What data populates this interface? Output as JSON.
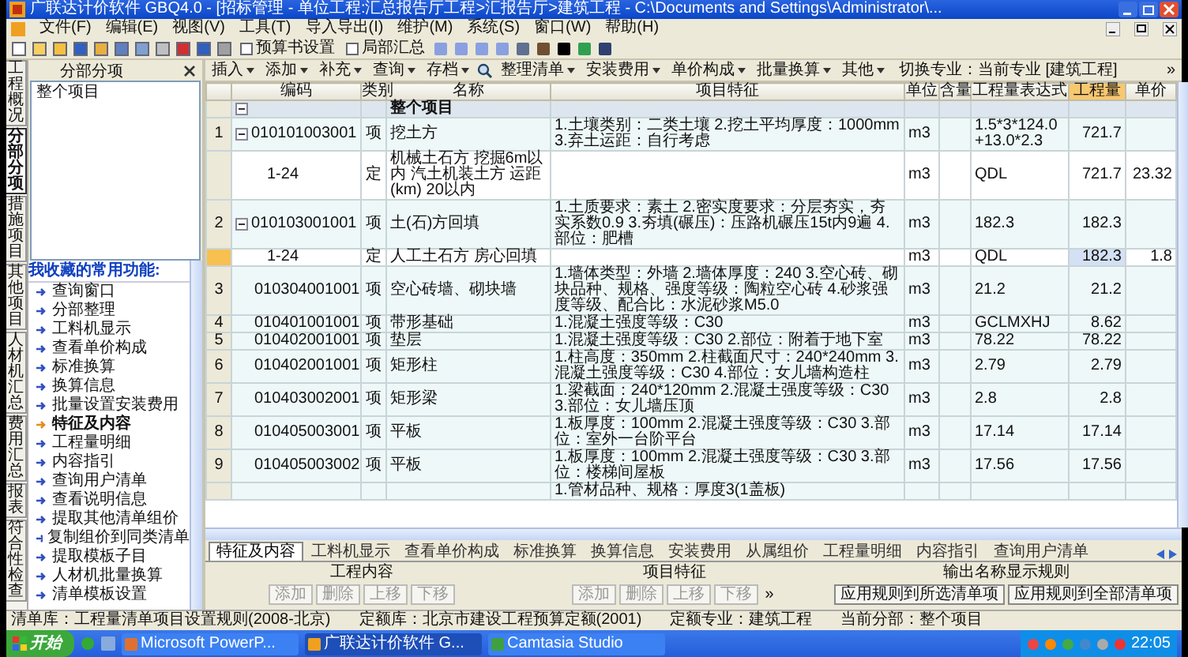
{
  "window": {
    "title": "广联达计价软件 GBQ4.0 - [招标管理 - 单位工程:汇总报告厅工程>汇报告厅>建筑工程 - C:\\Documents and Settings\\Administrator\\..."
  },
  "menu": [
    "文件(F)",
    "编辑(E)",
    "视图(V)",
    "工具(T)",
    "导入导出(I)",
    "维护(M)",
    "系统(S)",
    "窗口(W)",
    "帮助(H)"
  ],
  "toolbar": {
    "buttons": [
      "预算书设置",
      "局部汇总"
    ]
  },
  "side_tabs": [
    {
      "label": "工程概况",
      "selected": false
    },
    {
      "label": "分部分项",
      "selected": true
    },
    {
      "label": "措施项目",
      "selected": false
    },
    {
      "label": "其他项目",
      "selected": false
    },
    {
      "label": "人材机汇总",
      "selected": false
    },
    {
      "label": "费用汇总",
      "selected": false
    },
    {
      "label": "报表",
      "selected": false
    },
    {
      "label": "符合性检查",
      "selected": false
    }
  ],
  "left_panel": {
    "title": "分部分项",
    "tree": [
      "整个项目"
    ],
    "favorites_title": "我收藏的常用功能:",
    "favorites": [
      {
        "label": "查询窗口",
        "selected": false
      },
      {
        "label": "分部整理",
        "selected": false
      },
      {
        "label": "工料机显示",
        "selected": false
      },
      {
        "label": "查看单价构成",
        "selected": false
      },
      {
        "label": "标准换算",
        "selected": false
      },
      {
        "label": "换算信息",
        "selected": false
      },
      {
        "label": "批量设置安装费用",
        "selected": false
      },
      {
        "label": "特征及内容",
        "selected": true
      },
      {
        "label": "工程量明细",
        "selected": false
      },
      {
        "label": "内容指引",
        "selected": false
      },
      {
        "label": "查询用户清单",
        "selected": false
      },
      {
        "label": "查看说明信息",
        "selected": false
      },
      {
        "label": "提取其他清单组价",
        "selected": false
      },
      {
        "label": "复制组价到同类清单",
        "selected": false
      },
      {
        "label": "提取模板子目",
        "selected": false
      },
      {
        "label": "人材机批量换算",
        "selected": false
      },
      {
        "label": "清单模板设置",
        "selected": false
      }
    ]
  },
  "main_toolbar": {
    "items": [
      {
        "kind": "menu",
        "label": "插入"
      },
      {
        "kind": "menu",
        "label": "添加"
      },
      {
        "kind": "menu",
        "label": "补充"
      },
      {
        "kind": "menu",
        "label": "查询"
      },
      {
        "kind": "menu",
        "label": "存档"
      },
      {
        "kind": "search"
      },
      {
        "kind": "menu",
        "label": "整理清单"
      },
      {
        "kind": "menu",
        "label": "安装费用"
      },
      {
        "kind": "menu",
        "label": "单价构成"
      },
      {
        "kind": "menu",
        "label": "批量换算"
      },
      {
        "kind": "menu",
        "label": "其他"
      }
    ],
    "switch": "切换专业：当前专业 [建筑工程]",
    "more": "»"
  },
  "table": {
    "columns": [
      {
        "label": "编码",
        "selected": false
      },
      {
        "label": "类别",
        "selected": false
      },
      {
        "label": "名称",
        "selected": false
      },
      {
        "label": "项目特征",
        "selected": false
      },
      {
        "label": "单位",
        "selected": false
      },
      {
        "label": "含量",
        "selected": false
      },
      {
        "label": "工程量表达式",
        "selected": false
      },
      {
        "label": "工程量",
        "selected": true
      },
      {
        "label": "单价",
        "selected": false
      }
    ],
    "rows": [
      {
        "kind": "group",
        "name": "整个项目",
        "expanded": true,
        "selected": false
      },
      {
        "kind": "item",
        "no": "1",
        "code": "010101003001",
        "type": "项",
        "name": "挖土方",
        "features": "1.土壤类别：二类土壤 2.挖土平均厚度：1000mm 3.弃土运距：自行考虑",
        "unit": "m3",
        "expr": "1.5*3*124.0+13.0*2.3",
        "qty": "721.7",
        "expanded": true,
        "selected": false
      },
      {
        "kind": "quota",
        "code": "1-24",
        "type": "定",
        "name": "机械土石方 挖掘6m以内 汽土机装土方 运距(km) 20以内",
        "unit": "m3",
        "expr": "QDL",
        "qty": "721.7",
        "price": "23.32",
        "selected": false
      },
      {
        "kind": "item",
        "no": "2",
        "code": "010103001001",
        "type": "项",
        "name": "土(石)方回填",
        "features": "1.土质要求：素土 2.密实度要求：分层夯实，夯实系数0.9 3.夯填(碾压)：压路机碾压15t内9遍 4.部位：肥槽",
        "unit": "m3",
        "expr": "182.3",
        "qty": "182.3",
        "expanded": true,
        "selected": false
      },
      {
        "kind": "quota",
        "code": "1-24",
        "type": "定",
        "name": "人工土石方 房心回填",
        "unit": "m3",
        "expr": "QDL",
        "qty": "182.3",
        "price": "1.8",
        "selected": true
      },
      {
        "kind": "item",
        "no": "3",
        "code": "010304001001",
        "type": "项",
        "name": "空心砖墙、砌块墙",
        "features": "1.墙体类型：外墙 2.墙体厚度：240 3.空心砖、砌块品种、规格、强度等级：陶粒空心砖 4.砂浆强度等级、配合比：水泥砂浆M5.0",
        "unit": "m3",
        "expr": "21.2",
        "qty": "21.2",
        "selected": false
      },
      {
        "kind": "item",
        "no": "4",
        "code": "010401001001",
        "type": "项",
        "name": "带形基础",
        "features": "1.混凝土强度等级：C30",
        "unit": "m3",
        "expr": "GCLMXHJ",
        "qty": "8.62",
        "selected": false
      },
      {
        "kind": "item",
        "no": "5",
        "code": "010402001001",
        "type": "项",
        "name": "垫层",
        "features": "1.混凝土强度等级：C30 2.部位：附着于地下室",
        "unit": "m3",
        "expr": "78.22",
        "qty": "78.22",
        "selected": false
      },
      {
        "kind": "item",
        "no": "6",
        "code": "010402001001",
        "type": "项",
        "name": "矩形柱",
        "features": "1.柱高度：350mm 2.柱截面尺寸：240*240mm 3.混凝土强度等级：C30 4.部位：女儿墙构造柱",
        "unit": "m3",
        "expr": "2.79",
        "qty": "2.79",
        "selected": false
      },
      {
        "kind": "item",
        "no": "7",
        "code": "010403002001",
        "type": "项",
        "name": "矩形梁",
        "features": "1.梁截面：240*120mm 2.混凝土强度等级：C30 3.部位：女儿墙压顶",
        "unit": "m3",
        "expr": "2.8",
        "qty": "2.8",
        "selected": false
      },
      {
        "kind": "item",
        "no": "8",
        "code": "010405003001",
        "type": "项",
        "name": "平板",
        "features": "1.板厚度：100mm 2.混凝土强度等级：C30 3.部位：室外一台阶平台",
        "unit": "m3",
        "expr": "17.14",
        "qty": "17.14",
        "selected": false
      },
      {
        "kind": "item",
        "no": "9",
        "code": "010405003002",
        "type": "项",
        "name": "平板",
        "features": "1.板厚度：100mm 2.混凝土强度等级：C30 3.部位：楼梯间屋板",
        "unit": "m3",
        "expr": "17.56",
        "qty": "17.56",
        "selected": false
      },
      {
        "kind": "item",
        "features": "1.管材品种、规格：厚度3(1盖板)",
        "selected": false
      }
    ]
  },
  "bottom_tabs": [
    {
      "label": "特征及内容",
      "selected": true
    },
    {
      "label": "工料机显示",
      "selected": false
    },
    {
      "label": "查看单价构成",
      "selected": false
    },
    {
      "label": "标准换算",
      "selected": false
    },
    {
      "label": "换算信息",
      "selected": false
    },
    {
      "label": "安装费用",
      "selected": false
    },
    {
      "label": "从属组价",
      "selected": false
    },
    {
      "label": "工程量明细",
      "selected": false
    },
    {
      "label": "内容指引",
      "selected": false
    },
    {
      "label": "查询用户清单",
      "selected": false
    }
  ],
  "detail": {
    "sections": [
      {
        "title": "工程内容",
        "buttons": [
          {
            "label": "添加",
            "disabled": true
          },
          {
            "label": "删除",
            "disabled": true
          },
          {
            "label": "上移",
            "disabled": true
          },
          {
            "label": "下移",
            "disabled": true
          }
        ]
      },
      {
        "title": "项目特征",
        "buttons": [
          {
            "label": "添加",
            "disabled": true
          },
          {
            "label": "删除",
            "disabled": true
          },
          {
            "label": "上移",
            "disabled": true
          },
          {
            "label": "下移",
            "disabled": true
          }
        ],
        "more": "»"
      },
      {
        "title": "输出名称显示规则",
        "buttons": [
          {
            "label": "应用规则到所选清单项",
            "disabled": false
          },
          {
            "label": "应用规则到全部清单项",
            "disabled": false
          }
        ]
      }
    ]
  },
  "status_bar": [
    "清单库：工程量清单项目设置规则(2008-北京)",
    "定额库：北京市建设工程预算定额(2001)",
    "定额专业：建筑工程",
    "当前分部：整个项目"
  ],
  "taskbar": {
    "start": "开始",
    "tasks": [
      {
        "label": "Microsoft PowerP...",
        "selected": false
      },
      {
        "label": "广联达计价软件 G...",
        "selected": true
      },
      {
        "label": "Camtasia Studio",
        "selected": false
      }
    ],
    "clock": "22:05"
  }
}
